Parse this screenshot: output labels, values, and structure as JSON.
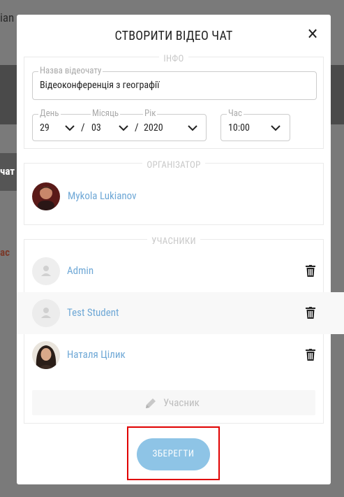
{
  "backdrop": {
    "text1": "ian",
    "text2": "чат",
    "text3": "ас"
  },
  "modal": {
    "title": "СТВОРИТИ ВІДЕО ЧАТ",
    "close_icon": "close-icon"
  },
  "info": {
    "legend": "ІНФО",
    "name_label": "Назва відеочату",
    "name_value": "Відеоконференція з географії",
    "day_label": "День",
    "day_value": "29",
    "month_label": "Місяць",
    "month_value": "03",
    "year_label": "Рік",
    "year_value": "2020",
    "separator": "/",
    "time_label": "Час",
    "time_value": "10:00"
  },
  "organizer": {
    "legend": "ОРГАНІЗАТОР",
    "name": "Mykola Lukianov"
  },
  "participants": {
    "legend": "УЧАСНИКИ",
    "items": [
      {
        "name": "Admin",
        "avatar": "placeholder"
      },
      {
        "name": "Test Student",
        "avatar": "placeholder"
      },
      {
        "name": "Наталя Цілик",
        "avatar": "photo"
      }
    ],
    "add_label": "Учасник",
    "add_icon": "pencil-icon",
    "delete_icon": "trash-icon"
  },
  "save_button": {
    "label": "ЗБЕРЕГТИ"
  },
  "colors": {
    "accent": "#8ec4e6",
    "link": "#6fa8d6",
    "highlight": "#e00000"
  }
}
